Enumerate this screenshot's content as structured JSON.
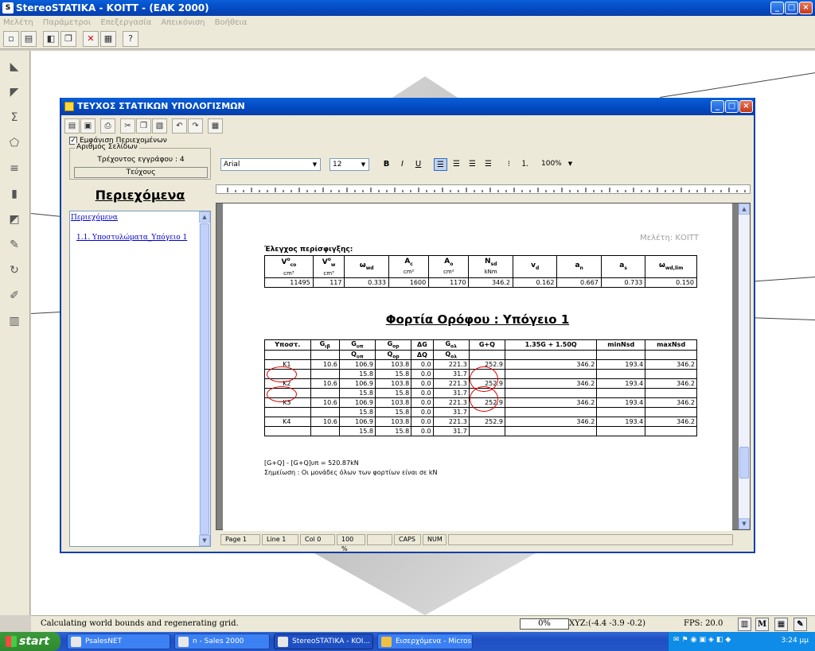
{
  "app": {
    "title": "StereoSTATIKA - ΚΟΙΤΤ - (ΕΑΚ 2000)",
    "menus": [
      "Μελέτη",
      "Παράμετροι",
      "Επεξεργασία",
      "Απεικόνιση",
      "Βοήθεια"
    ]
  },
  "docwin": {
    "title": "ΤΕΥΧΟΣ ΣΤΑΤΙΚΩΝ ΥΠΟΛΟΓΙΣΜΩΝ",
    "show_contents_label": "Εμφάνιση Περιεχομένων",
    "pages_group_label": "Αριθμός Σελίδων",
    "current_doc_label": "Τρέχοντος εγγράφου : 4",
    "teuxos_button": "Τεύχους",
    "toc_heading": "Περιεχόμενα",
    "toc_items": [
      "Περιεχόμενα",
      "1.1. Υποστυλώματα_Υπόγειο 1"
    ],
    "font_name": "Arial",
    "font_size": "12",
    "zoom": "100%",
    "status": {
      "page": "Page 1",
      "line": "Line 1",
      "col": "Col 0",
      "zoom": "100 %",
      "caps": "CAPS",
      "num": "NUM"
    }
  },
  "page": {
    "header_right": "Μελέτη: ΚΟΙΤΤ",
    "confinement_title": "Έλεγχος περίσφιγξης:",
    "tableA": {
      "headers": [
        {
          "t": "V",
          "sup": "o",
          "sub": "co",
          "unit": "cm³"
        },
        {
          "t": "V",
          "sup": "o",
          "sub": "w",
          "unit": "cm³"
        },
        {
          "t": "ω",
          "sub": "wd",
          "unit": ""
        },
        {
          "t": "A",
          "sub": "c",
          "unit": "cm²"
        },
        {
          "t": "A",
          "sub": "o",
          "unit": "cm²"
        },
        {
          "t": "N",
          "sub": "sd",
          "unit": "kNm"
        },
        {
          "t": "v",
          "sub": "d",
          "unit": ""
        },
        {
          "t": "a",
          "sub": "n",
          "unit": ""
        },
        {
          "t": "a",
          "sub": "s",
          "unit": ""
        },
        {
          "t": "ω",
          "sub": "wd,lim",
          "unit": ""
        }
      ],
      "row": [
        "11495",
        "117",
        "0.333",
        "1600",
        "1170",
        "346.2",
        "0.162",
        "0.667",
        "0.733",
        "0.150"
      ]
    },
    "section_title": "Φορτία Ορόφου : Υπόγειο 1",
    "tableB": {
      "headers": [
        {
          "t": "Υποστ."
        },
        {
          "t": "G",
          "sub": "ιβ"
        },
        {
          "t": "G",
          "sub": "υπ"
        },
        {
          "t": "G",
          "sub": "οp"
        },
        {
          "t": "ΔG"
        },
        {
          "t": "G",
          "sub": "ολ"
        },
        {
          "t": "G+Q"
        },
        {
          "t": "1.35G + 1.50Q"
        },
        {
          "t": "minNsd"
        },
        {
          "t": "maxNsd"
        }
      ],
      "subheaders": [
        "",
        "",
        "Q_υπ",
        "Q_οp",
        "ΔQ",
        "Q_ολ",
        "",
        "",
        "",
        ""
      ],
      "rows": [
        [
          "K1",
          "10.6",
          "106.9",
          "103.8",
          "0.0",
          "221.3",
          "252.9",
          "346.2",
          "193.4",
          "346.2"
        ],
        [
          "",
          "",
          "15.8",
          "15.8",
          "0.0",
          "31.7",
          "",
          "",
          "",
          ""
        ],
        [
          "K2",
          "10.6",
          "106.9",
          "103.8",
          "0.0",
          "221.3",
          "252.9",
          "346.2",
          "193.4",
          "346.2"
        ],
        [
          "",
          "",
          "15.8",
          "15.8",
          "0.0",
          "31.7",
          "",
          "",
          "",
          ""
        ],
        [
          "K3",
          "10.6",
          "106.9",
          "103.8",
          "0.0",
          "221.3",
          "252.9",
          "346.2",
          "193.4",
          "346.2"
        ],
        [
          "",
          "",
          "15.8",
          "15.8",
          "0.0",
          "31.7",
          "",
          "",
          "",
          ""
        ],
        [
          "K4",
          "10.6",
          "106.9",
          "103.8",
          "0.0",
          "221.3",
          "252.9",
          "346.2",
          "193.4",
          "346.2"
        ],
        [
          "",
          "",
          "15.8",
          "15.8",
          "0.0",
          "31.7",
          "",
          "",
          "",
          ""
        ]
      ]
    },
    "note1": "[G+Q] - [G+Q]υπ = 520.87kN",
    "note2": "Σημείωση : Οι μονάδες όλων των φορτίων είναι σε kN"
  },
  "status": {
    "message": "Calculating world bounds and regenerating grid.",
    "progress": "0%",
    "xyz": "XYZ:(-4.4  -3.9  -0.2)",
    "fps": "FPS: 20.0",
    "m_label": "M"
  },
  "taskbar": {
    "start": "start",
    "tasks": [
      "PsalesNET",
      "n - Sales 2000",
      "StereoSTATIKA - KOI...",
      "Εισερχόμενα - Micros..."
    ],
    "clock": "3:24 μμ"
  }
}
